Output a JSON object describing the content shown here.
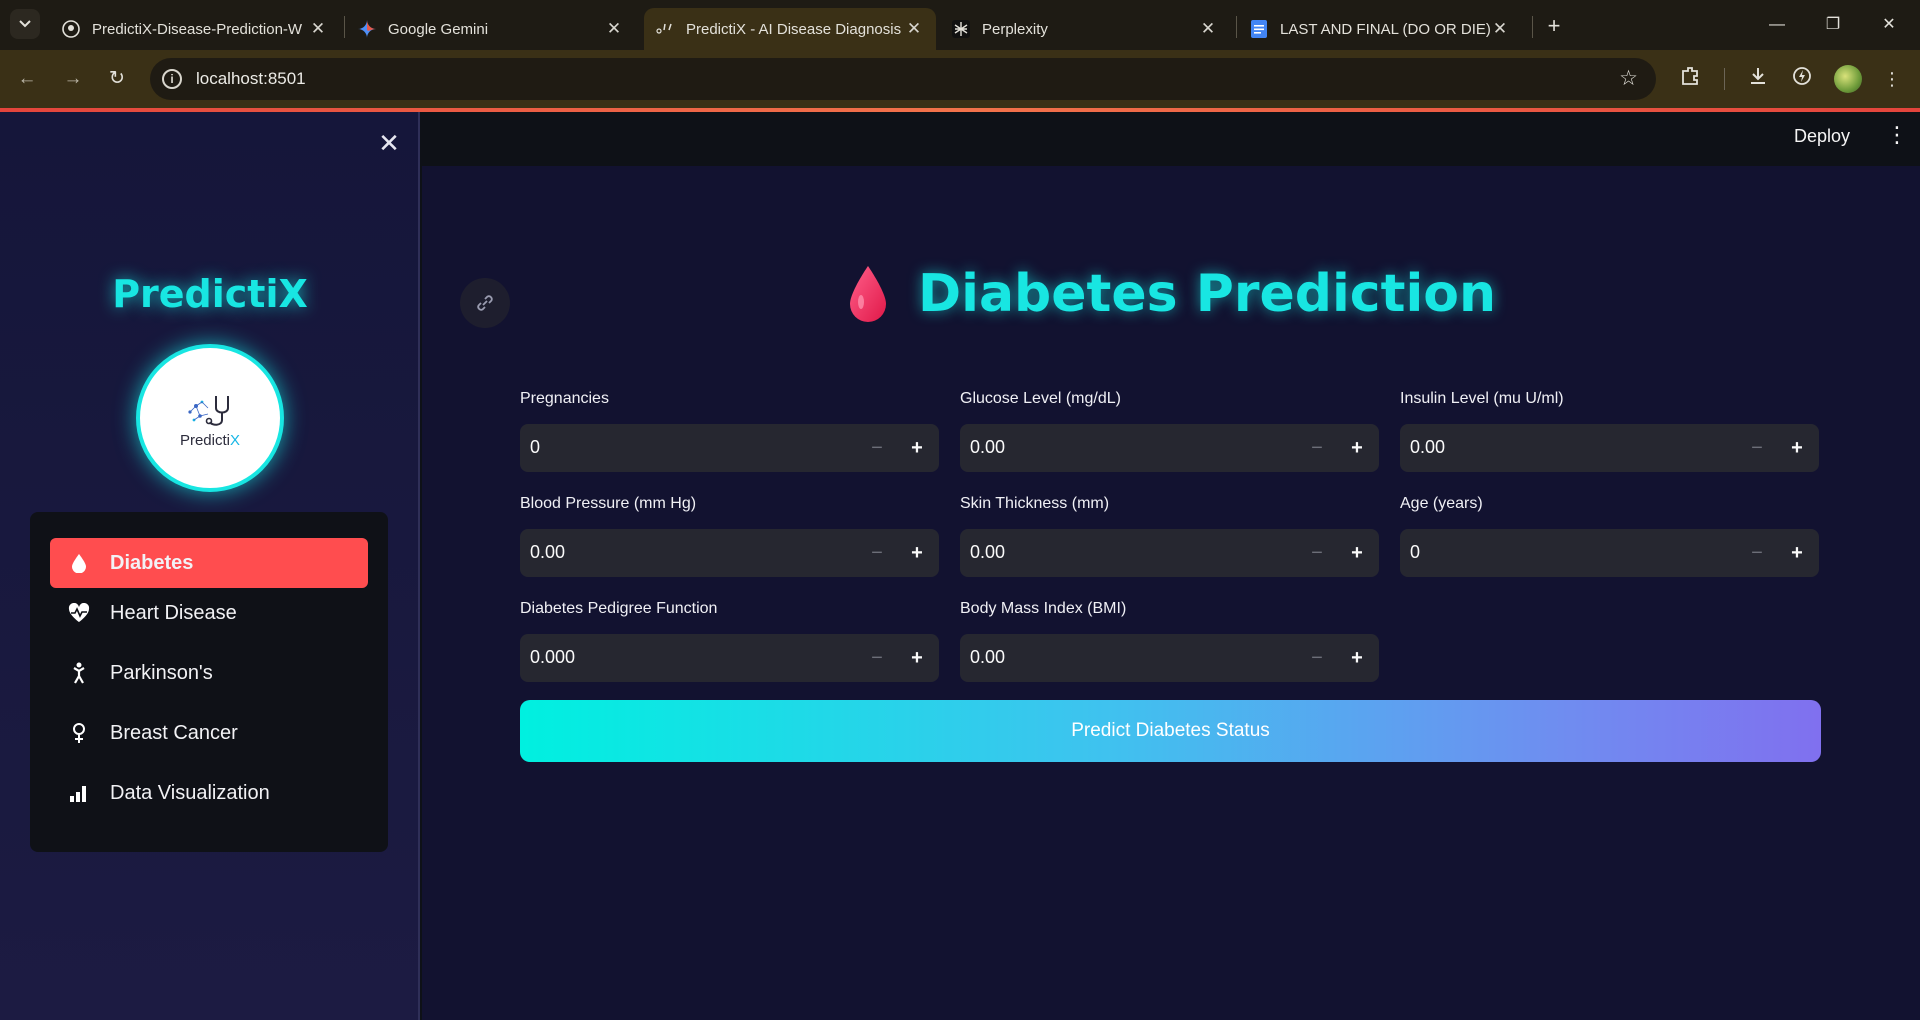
{
  "browser": {
    "tabs": [
      {
        "title": "PredictiX-Disease-Prediction-W",
        "icon": "github-icon"
      },
      {
        "title": "Google Gemini",
        "icon": "gemini-icon"
      },
      {
        "title": "PredictiX - AI Disease Diagnosis",
        "icon": "loading-icon",
        "active": true
      },
      {
        "title": "Perplexity",
        "icon": "perplexity-icon"
      },
      {
        "title": "LAST AND FINAL (DO OR DIE) -",
        "icon": "docs-icon"
      }
    ],
    "url": "localhost:8501"
  },
  "app": {
    "deploy_label": "Deploy"
  },
  "sidebar": {
    "brand": "PredictiX",
    "logo_text_main": "Predicti",
    "logo_text_accent": "X",
    "menu": [
      {
        "label": "Diabetes",
        "icon": "droplet-icon",
        "active": true
      },
      {
        "label": "Heart Disease",
        "icon": "heart-pulse-icon"
      },
      {
        "label": "Parkinson's",
        "icon": "person-icon"
      },
      {
        "label": "Breast Cancer",
        "icon": "female-symbol-icon"
      },
      {
        "label": "Data Visualization",
        "icon": "bar-chart-icon"
      }
    ]
  },
  "main": {
    "title": "Diabetes Prediction",
    "fields": [
      {
        "label": "Pregnancies",
        "value": "0"
      },
      {
        "label": "Glucose Level (mg/dL)",
        "value": "0.00"
      },
      {
        "label": "Insulin Level (mu U/ml)",
        "value": "0.00"
      },
      {
        "label": "Blood Pressure (mm Hg)",
        "value": "0.00"
      },
      {
        "label": "Skin Thickness (mm)",
        "value": "0.00"
      },
      {
        "label": "Age (years)",
        "value": "0"
      },
      {
        "label": "Diabetes Pedigree Function",
        "value": "0.000"
      },
      {
        "label": "Body Mass Index (BMI)",
        "value": "0.00"
      }
    ],
    "predict_label": "Predict Diabetes Status"
  },
  "colors": {
    "accent_cyan": "#18e6e2",
    "active_menu": "#ff4d4f",
    "sidebar_bg": "#15163a",
    "main_bg": "#121230"
  }
}
